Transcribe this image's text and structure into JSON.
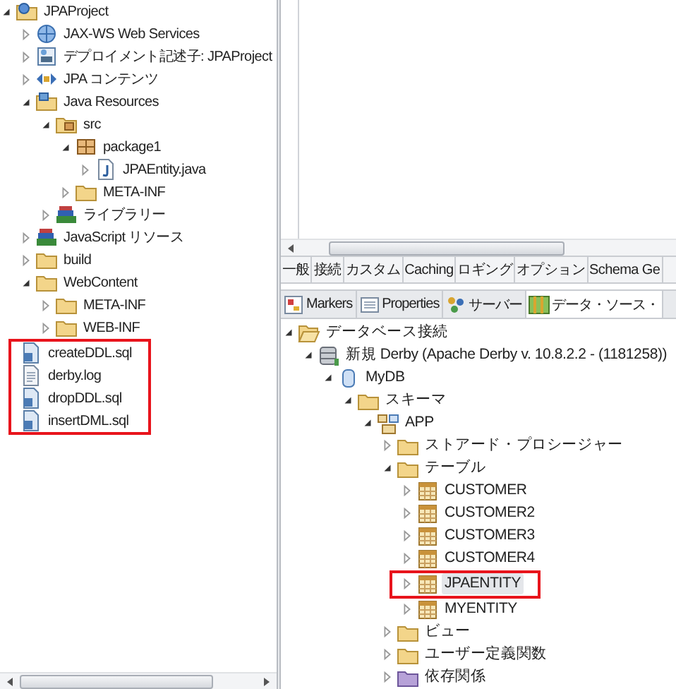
{
  "project_explorer": {
    "tree": [
      {
        "label": "JPAProject",
        "kind": "project",
        "expanded": true,
        "selected": false,
        "boxed": false,
        "children": [
          {
            "label": "JAX-WS Web Services",
            "kind": "web-services",
            "expanded": false,
            "selected": false,
            "boxed": false
          },
          {
            "label": "デプロイメント記述子: JPAProject",
            "kind": "deployment",
            "expanded": false,
            "selected": false,
            "boxed": false
          },
          {
            "label": "JPA コンテンツ",
            "kind": "jpa",
            "expanded": false,
            "selected": false,
            "boxed": false
          },
          {
            "label": "Java Resources",
            "kind": "java-resources",
            "expanded": true,
            "selected": false,
            "boxed": false,
            "children": [
              {
                "label": "src",
                "kind": "source-folder",
                "expanded": true,
                "selected": false,
                "boxed": false,
                "children": [
                  {
                    "label": "package1",
                    "kind": "package",
                    "expanded": true,
                    "selected": false,
                    "boxed": false,
                    "children": [
                      {
                        "label": "JPAEntity.java",
                        "kind": "java-file",
                        "expanded": false,
                        "selected": false,
                        "boxed": false
                      }
                    ]
                  },
                  {
                    "label": "META-INF",
                    "kind": "folder",
                    "expanded": false,
                    "selected": false,
                    "boxed": false
                  }
                ]
              },
              {
                "label": "ライブラリー",
                "kind": "library",
                "expanded": false,
                "selected": false,
                "boxed": false
              }
            ]
          },
          {
            "label": "JavaScript リソース",
            "kind": "library",
            "expanded": false,
            "selected": false,
            "boxed": false
          },
          {
            "label": "build",
            "kind": "folder",
            "expanded": false,
            "selected": false,
            "boxed": false
          },
          {
            "label": "WebContent",
            "kind": "folder",
            "expanded": true,
            "selected": false,
            "boxed": false,
            "children": [
              {
                "label": "META-INF",
                "kind": "folder",
                "expanded": false,
                "selected": false,
                "boxed": false
              },
              {
                "label": "WEB-INF",
                "kind": "folder",
                "expanded": false,
                "selected": false,
                "boxed": false
              }
            ]
          },
          {
            "label": "createDDL.sql",
            "kind": "sql-file",
            "selected": false,
            "boxed": true
          },
          {
            "label": "derby.log",
            "kind": "text-file",
            "selected": false,
            "boxed": true
          },
          {
            "label": "dropDDL.sql",
            "kind": "sql-file",
            "selected": false,
            "boxed": true
          },
          {
            "label": "insertDML.sql",
            "kind": "sql-file",
            "selected": false,
            "boxed": true
          }
        ]
      }
    ]
  },
  "property_tabs": [
    "一般",
    "接続",
    "カスタム",
    "Caching",
    "ロギング",
    "オプション",
    "Schema Ge"
  ],
  "view_tabs": [
    {
      "label": "Markers",
      "kind": "markers",
      "selected": false
    },
    {
      "label": "Properties",
      "kind": "properties",
      "selected": false
    },
    {
      "label": "サーバー",
      "kind": "servers",
      "selected": false
    },
    {
      "label": "データ・ソース・",
      "kind": "data-source",
      "selected": true
    }
  ],
  "data_source_explorer": {
    "tree": [
      {
        "label": "データベース接続",
        "kind": "open-folder",
        "expanded": true,
        "selected": false,
        "boxed": false,
        "children": [
          {
            "label": "新規 Derby (Apache Derby v. 10.8.2.2 - (1181258))",
            "kind": "connection",
            "expanded": true,
            "selected": false,
            "boxed": false,
            "children": [
              {
                "label": "MyDB",
                "kind": "database",
                "expanded": true,
                "selected": false,
                "boxed": false,
                "children": [
                  {
                    "label": "スキーマ",
                    "kind": "folder",
                    "expanded": true,
                    "selected": false,
                    "boxed": false,
                    "children": [
                      {
                        "label": "APP",
                        "kind": "schema",
                        "expanded": true,
                        "selected": false,
                        "boxed": false,
                        "children": [
                          {
                            "label": "ストアード・プロシージャー",
                            "kind": "folder",
                            "expanded": false,
                            "selected": false,
                            "boxed": false
                          },
                          {
                            "label": "テーブル",
                            "kind": "folder",
                            "expanded": true,
                            "selected": false,
                            "boxed": false,
                            "children": [
                              {
                                "label": "CUSTOMER",
                                "kind": "table",
                                "expanded": false,
                                "selected": false,
                                "boxed": false
                              },
                              {
                                "label": "CUSTOMER2",
                                "kind": "table",
                                "expanded": false,
                                "selected": false,
                                "boxed": false
                              },
                              {
                                "label": "CUSTOMER3",
                                "kind": "table",
                                "expanded": false,
                                "selected": false,
                                "boxed": false
                              },
                              {
                                "label": "CUSTOMER4",
                                "kind": "table",
                                "expanded": false,
                                "selected": false,
                                "boxed": false
                              },
                              {
                                "label": "JPAENTITY",
                                "kind": "table",
                                "expanded": false,
                                "selected": true,
                                "boxed": true
                              },
                              {
                                "label": "MYENTITY",
                                "kind": "table",
                                "expanded": false,
                                "selected": false,
                                "boxed": false
                              }
                            ]
                          },
                          {
                            "label": "ビュー",
                            "kind": "folder",
                            "expanded": false,
                            "selected": false,
                            "boxed": false
                          },
                          {
                            "label": "ユーザー定義関数",
                            "kind": "folder",
                            "expanded": false,
                            "selected": false,
                            "boxed": false
                          },
                          {
                            "label": "依存関係",
                            "kind": "purple-folder",
                            "expanded": false,
                            "selected": false,
                            "boxed": false
                          }
                        ]
                      }
                    ]
                  }
                ]
              }
            ]
          }
        ]
      }
    ]
  }
}
